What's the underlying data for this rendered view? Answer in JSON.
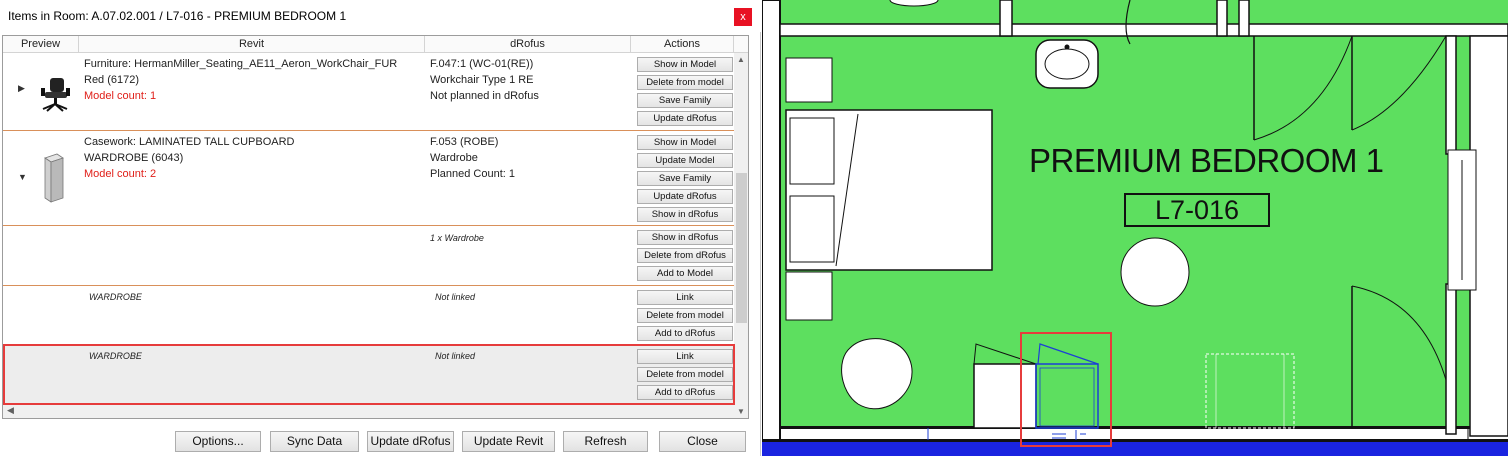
{
  "dialog": {
    "title": "Items in Room: A.07.02.001 / L7-016 - PREMIUM BEDROOM 1",
    "close_glyph": "x",
    "columns": [
      "Preview",
      "Revit",
      "dRofus",
      "Actions"
    ],
    "rows": [
      {
        "expander": "right",
        "revit_lines": [
          "Furniture: HermanMiller_Seating_AE11_Aeron_WorkChair_FUR",
          "Red (6172)"
        ],
        "revit_count": "Model count: 1",
        "drofus_lines": [
          "F.047:1 (WC-01(RE))",
          "Workchair Type 1 RE",
          "Not planned in dRofus"
        ],
        "actions": [
          "Show in Model",
          "Delete from model",
          "Save Family",
          "Update dRofus"
        ]
      },
      {
        "expander": "down",
        "revit_lines": [
          "Casework: LAMINATED TALL CUPBOARD",
          "WARDROBE (6043)"
        ],
        "revit_count": "Model count: 2",
        "drofus_lines": [
          "F.053 (ROBE)",
          "Wardrobe",
          "Planned Count: 1"
        ],
        "actions": [
          "Show in Model",
          "Update Model",
          "Save Family",
          "Update dRofus",
          "Show in dRofus"
        ]
      },
      {
        "drofus_note": "1 x Wardrobe",
        "actions": [
          "Show in dRofus",
          "Delete from dRofus",
          "Add to Model"
        ]
      },
      {
        "revit_note": "WARDROBE",
        "drofus_note": "Not linked",
        "actions": [
          "Link",
          "Delete from model",
          "Add to dRofus"
        ]
      },
      {
        "revit_note": "WARDROBE",
        "drofus_note": "Not linked",
        "actions": [
          "Link",
          "Delete from model",
          "Add to dRofus"
        ],
        "highlighted": true
      }
    ],
    "footer_buttons": [
      "Options...",
      "Sync Data",
      "Update dRofus",
      "Update Revit",
      "Refresh",
      "Close"
    ]
  },
  "plan": {
    "room_name": "PREMIUM BEDROOM 1",
    "room_number": "L7-016",
    "colors": {
      "room_fill": "#5ddf5f",
      "floor_strip": "#1a24e0",
      "walls": "#111111",
      "highlight": "#e63c3c",
      "selected_element": "#1c3fd6"
    }
  }
}
